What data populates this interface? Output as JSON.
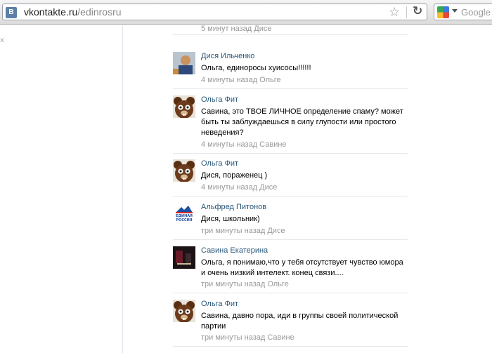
{
  "browser": {
    "site_icon": "В",
    "url_host": "vkontakte.ru",
    "url_path": "/edinrosru",
    "search_placeholder": "Google",
    "icons": [
      "vk-site-icon",
      "star-icon",
      "reload-icon",
      "google-icon",
      "chevron-down-icon"
    ]
  },
  "left_fragment": "x",
  "comments": [
    {
      "name": "",
      "text": "Дися, пораженец )",
      "meta": "5 минут назад Дисе",
      "avatar": "bear"
    },
    {
      "name": "Дися Ильченко",
      "text": "Ольга, единоросы хуисосы!!!!!!",
      "meta": "4 минуты назад Ольге",
      "avatar": "photo"
    },
    {
      "name": "Ольга Фит",
      "text": "Савина, это ТВОЕ ЛИЧНОЕ определение спаму? может быть ты заблуждаешься в силу глупости или простого неведения?",
      "meta": "4 минуты назад Савине",
      "avatar": "bear"
    },
    {
      "name": "Ольга Фит",
      "text": "Дися, пораженец )",
      "meta": "4 минуты назад Дисе",
      "avatar": "bear"
    },
    {
      "name": "Альфред Питонов",
      "text": "Дися, школьник)",
      "meta": "три минуты назад Дисе",
      "avatar": "er-logo",
      "logo_text": "ЕДИНАЯ РОССИЯ"
    },
    {
      "name": "Савина Екатерина",
      "text": "Ольга, я понимаю,что у тебя отсутствует чувство юмора и очень низкий интелект. конец связи....",
      "meta": "три минуты назад Ольге",
      "avatar": "dark"
    },
    {
      "name": "Ольга Фит",
      "text": "Савина, давно пора, иди в группы своей политической партии",
      "meta": "три минуты назад Савине",
      "avatar": "bear"
    }
  ],
  "colors": {
    "link": "#2b587a",
    "meta": "#999999",
    "divider": "#e4e8ec"
  }
}
